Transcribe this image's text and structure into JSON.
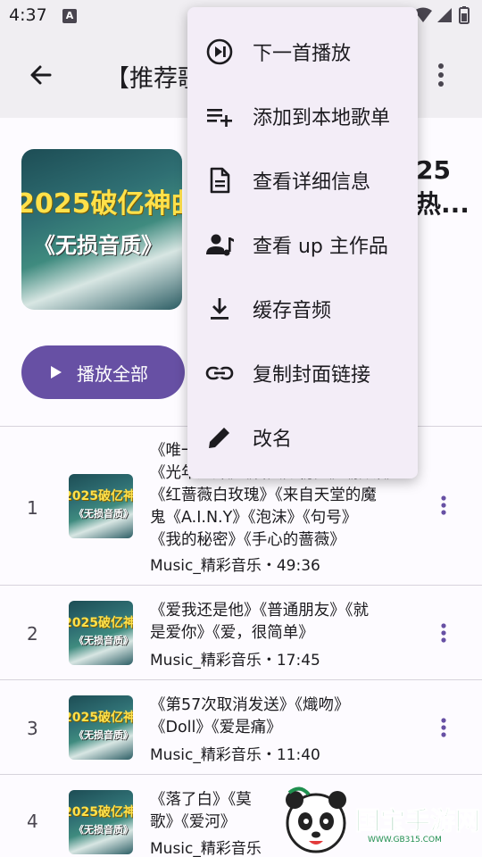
{
  "status_bar": {
    "time": "4:37",
    "notification_icon": "A"
  },
  "header": {
    "title": "【推荐歌",
    "back_icon": "arrow-left-icon",
    "more_icon": "more-vert-icon"
  },
  "playlist": {
    "cover_text_line1": "2025破亿神曲",
    "cover_text_line2": "《无损音质》",
    "title": "25\n热...",
    "play_all_label": "播放全部"
  },
  "menu": {
    "items": [
      {
        "label": "下一首播放",
        "icon": "play-next-icon"
      },
      {
        "label": "添加到本地歌单",
        "icon": "playlist-add-icon"
      },
      {
        "label": "查看详细信息",
        "icon": "document-icon"
      },
      {
        "label": "查看 up 主作品",
        "icon": "person-music-icon"
      },
      {
        "label": "缓存音频",
        "icon": "download-icon"
      },
      {
        "label": "复制封面链接",
        "icon": "link-icon"
      },
      {
        "label": "改名",
        "icon": "pencil-icon"
      }
    ]
  },
  "songs": [
    {
      "index": "1",
      "title_lines": [
        "《唯一",
        "《光年之外》《若只如初见》《预谋》",
        "《红蔷薇白玫瑰》《来自天堂的魔",
        "鬼《A.I.N.Y》《泡沫》《句号》",
        "《我的秘密》《手心的蔷薇》"
      ],
      "meta": "Music_精彩音乐・49:36"
    },
    {
      "index": "2",
      "title_lines": [
        "《爱我还是他》《普通朋友》《就",
        "是爱你》《爱，很简单》"
      ],
      "meta": "Music_精彩音乐・17:45"
    },
    {
      "index": "3",
      "title_lines": [
        "《第57次取消发送》《熾吻》",
        "《Doll》《爱是痛》"
      ],
      "meta": "Music_精彩音乐・11:40"
    },
    {
      "index": "4",
      "title_lines": [
        "《落了白》《莫",
        "歌》《爱河》"
      ],
      "meta": "Music_精彩音乐"
    }
  ],
  "watermark": {
    "name": "国宝手游网",
    "url": "WWW.GB315.COM"
  },
  "colors": {
    "primary": "#6750a4",
    "surface": "#fdfbff",
    "top_bar": "#f0eef2",
    "menu_bg": "#f3edf7"
  }
}
